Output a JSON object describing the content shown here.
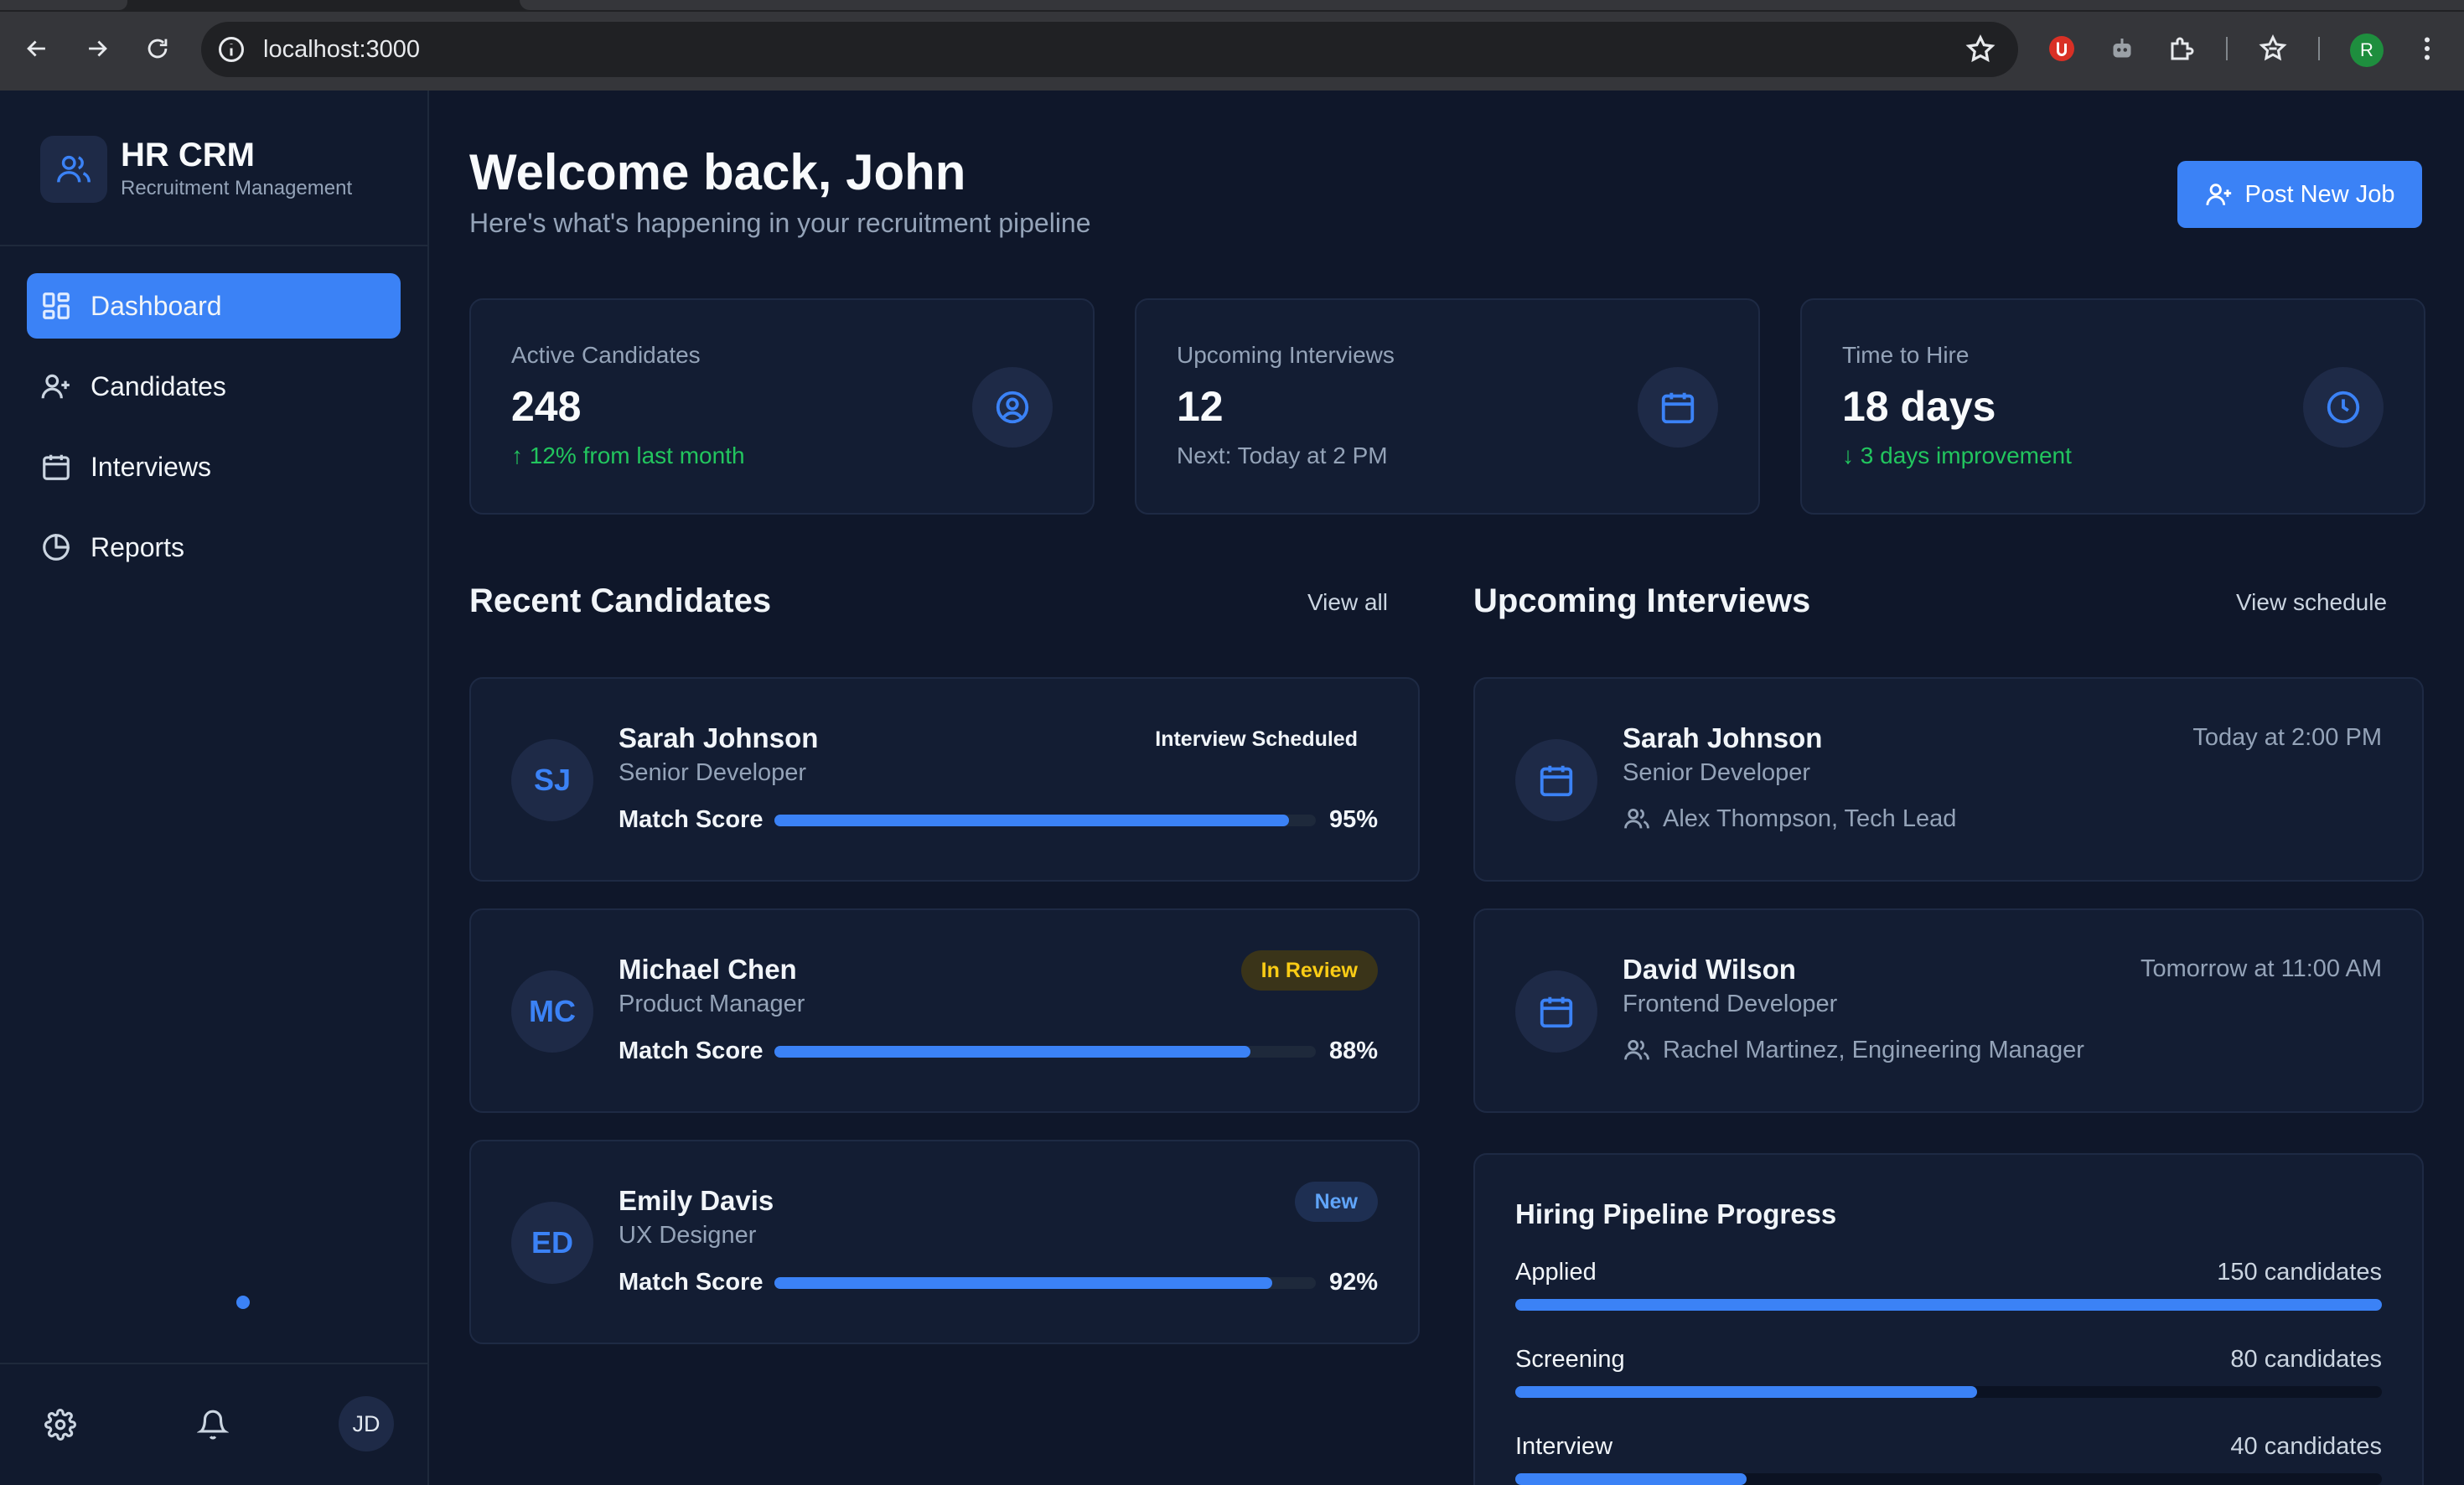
{
  "browser": {
    "url": "localhost:3000",
    "profile_initial": "R"
  },
  "sidebar": {
    "brand_title": "HR CRM",
    "brand_subtitle": "Recruitment Management",
    "items": [
      {
        "label": "Dashboard",
        "icon": "dashboard-icon",
        "active": true
      },
      {
        "label": "Candidates",
        "icon": "user-plus-icon",
        "active": false
      },
      {
        "label": "Interviews",
        "icon": "calendar-icon",
        "active": false
      },
      {
        "label": "Reports",
        "icon": "pie-chart-icon",
        "active": false
      }
    ],
    "user_initials": "JD"
  },
  "header": {
    "title": "Welcome back, John",
    "subtitle": "Here's what's happening in your recruitment pipeline",
    "post_job_label": "Post New Job"
  },
  "stats": [
    {
      "label": "Active Candidates",
      "value": "248",
      "note": "12% from last month",
      "note_arrow": "↑",
      "icon": "user-circle-icon"
    },
    {
      "label": "Upcoming Interviews",
      "value": "12",
      "note": "Next: Today at 2 PM",
      "icon": "calendar-icon"
    },
    {
      "label": "Time to Hire",
      "value": "18 days",
      "note": "3 days improvement",
      "note_arrow": "↓",
      "icon": "clock-icon"
    }
  ],
  "recent_candidates": {
    "title": "Recent Candidates",
    "link": "View all",
    "match_label": "Match Score",
    "items": [
      {
        "initials": "SJ",
        "name": "Sarah Johnson",
        "role": "Senior Developer",
        "status": "Interview Scheduled",
        "score": 95,
        "score_label": "95%"
      },
      {
        "initials": "MC",
        "name": "Michael Chen",
        "role": "Product Manager",
        "status": "In Review",
        "score": 88,
        "score_label": "88%"
      },
      {
        "initials": "ED",
        "name": "Emily Davis",
        "role": "UX Designer",
        "status": "New",
        "score": 92,
        "score_label": "92%"
      }
    ]
  },
  "upcoming_interviews": {
    "title": "Upcoming Interviews",
    "link": "View schedule",
    "items": [
      {
        "name": "Sarah Johnson",
        "role": "Senior Developer",
        "interviewer": "Alex Thompson, Tech Lead",
        "time": "Today at 2:00 PM"
      },
      {
        "name": "David Wilson",
        "role": "Frontend Developer",
        "interviewer": "Rachel Martinez, Engineering Manager",
        "time": "Tomorrow at 11:00 AM"
      }
    ]
  },
  "pipeline": {
    "title": "Hiring Pipeline Progress",
    "max": 150,
    "stages": [
      {
        "name": "Applied",
        "count": 150,
        "count_label": "150 candidates"
      },
      {
        "name": "Screening",
        "count": 80,
        "count_label": "80 candidates"
      },
      {
        "name": "Interview",
        "count": 40,
        "count_label": "40 candidates"
      }
    ]
  },
  "colors": {
    "accent": "#3b82f6",
    "background": "#0f172a",
    "card": "#131d33",
    "positive": "#22c55e",
    "warning": "#facc15"
  }
}
